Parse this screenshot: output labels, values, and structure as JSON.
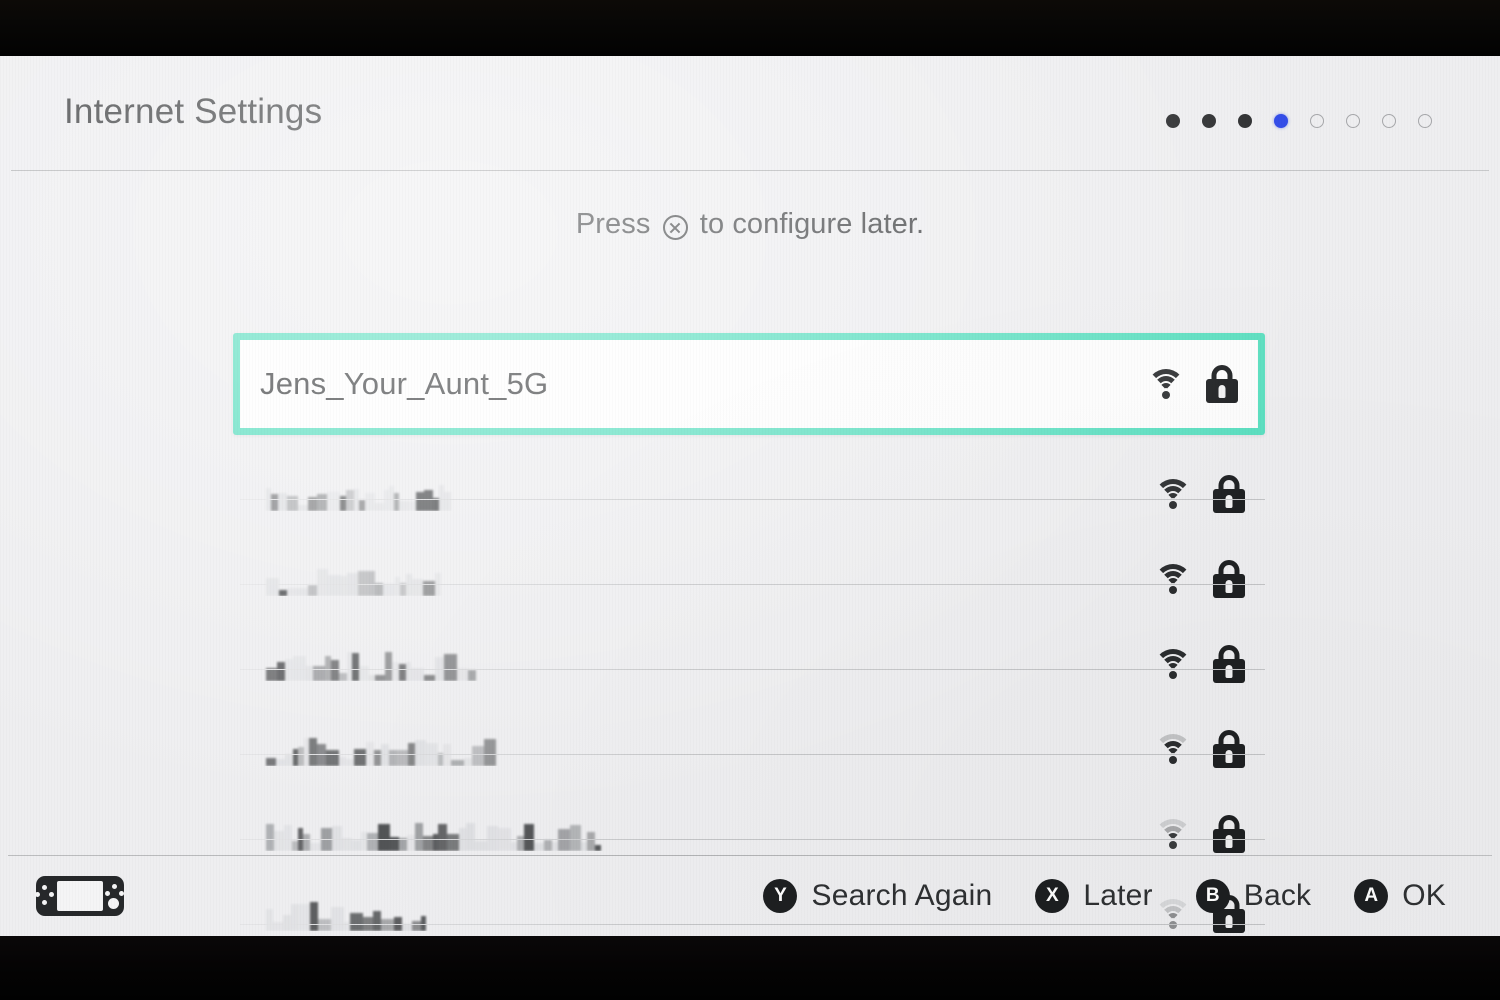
{
  "device": {
    "bezel_color": "#050505",
    "screen_bg": "#eeeef0",
    "accent_color": "#5bdfc0",
    "active_dot_color": "#2f49e8"
  },
  "header": {
    "title": "Internet Settings",
    "page_dots": [
      {
        "state": "filled"
      },
      {
        "state": "filled"
      },
      {
        "state": "filled"
      },
      {
        "state": "active"
      },
      {
        "state": "hollow"
      },
      {
        "state": "hollow"
      },
      {
        "state": "hollow"
      },
      {
        "state": "hollow"
      }
    ],
    "page_current": 4,
    "page_total": 8
  },
  "prompt": {
    "before": "Press ",
    "icon": "x-button-icon",
    "after": " to configure later."
  },
  "networks": [
    {
      "ssid": "Jens_Your_Aunt_5G",
      "selected": true,
      "redacted": false,
      "signal": 4,
      "secured": true,
      "wifi_icon": "wifi-icon",
      "lock_icon": "lock-icon"
    },
    {
      "ssid": "",
      "selected": false,
      "redacted": true,
      "signal": 4,
      "secured": true,
      "wifi_icon": "wifi-icon",
      "lock_icon": "lock-icon"
    },
    {
      "ssid": "",
      "selected": false,
      "redacted": true,
      "signal": 4,
      "secured": true,
      "wifi_icon": "wifi-icon",
      "lock_icon": "lock-icon"
    },
    {
      "ssid": "",
      "selected": false,
      "redacted": true,
      "signal": 4,
      "secured": true,
      "wifi_icon": "wifi-icon",
      "lock_icon": "lock-icon"
    },
    {
      "ssid": "",
      "selected": false,
      "redacted": true,
      "signal": 3,
      "secured": true,
      "wifi_icon": "wifi-icon",
      "lock_icon": "lock-icon"
    },
    {
      "ssid": "",
      "selected": false,
      "redacted": true,
      "signal": 2,
      "secured": true,
      "wifi_icon": "wifi-icon",
      "lock_icon": "lock-icon"
    },
    {
      "ssid": "",
      "selected": false,
      "redacted": true,
      "signal": 1,
      "secured": true,
      "wifi_icon": "wifi-icon",
      "lock_icon": "lock-icon"
    }
  ],
  "footer": {
    "console_icon": "switch-console-icon",
    "hints": [
      {
        "button": "Y",
        "label": "Search Again"
      },
      {
        "button": "X",
        "label": "Later"
      },
      {
        "button": "B",
        "label": "Back"
      },
      {
        "button": "A",
        "label": "OK"
      }
    ]
  }
}
